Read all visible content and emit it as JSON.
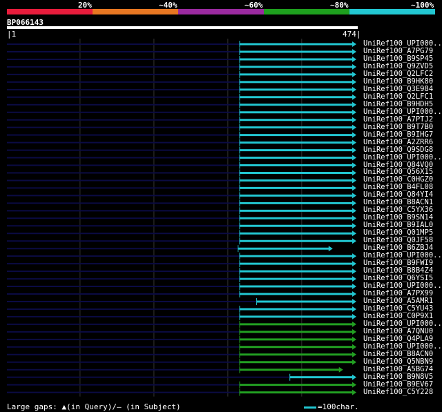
{
  "colors": {
    "dark_line": "#0b0b44",
    "cyan": "#22c7d2",
    "green": "#22a022",
    "red": "#e81c3c",
    "orange": "#e87722",
    "purple": "#9b2aa0",
    "grid": "#333333"
  },
  "legend": {
    "labels": [
      "20%",
      "~40%",
      "~60%",
      "~80%",
      "~100%"
    ],
    "colors": [
      "#e81c3c",
      "#e87722",
      "#9b2aa0",
      "#1ea01e",
      "#22c7d2"
    ]
  },
  "query": {
    "name": "BP066143",
    "start": "|1",
    "end": "474|"
  },
  "hits": [
    {
      "label": "UniRef100_UPI000..",
      "start": 316,
      "end": 474,
      "color": "cyan"
    },
    {
      "label": "UniRef100_A7PG79",
      "start": 316,
      "end": 474,
      "color": "cyan"
    },
    {
      "label": "UniRef100_B9SP45",
      "start": 316,
      "end": 474,
      "color": "cyan"
    },
    {
      "label": "UniRef100_Q9ZVD5",
      "start": 316,
      "end": 474,
      "color": "cyan"
    },
    {
      "label": "UniRef100_Q2LFC2",
      "start": 316,
      "end": 474,
      "color": "cyan"
    },
    {
      "label": "UniRef100_B9HK80",
      "start": 316,
      "end": 474,
      "color": "cyan"
    },
    {
      "label": "UniRef100_Q3E984",
      "start": 316,
      "end": 474,
      "color": "cyan"
    },
    {
      "label": "UniRef100_Q2LFC1",
      "start": 316,
      "end": 474,
      "color": "cyan"
    },
    {
      "label": "UniRef100_B9HDH5",
      "start": 316,
      "end": 474,
      "color": "cyan"
    },
    {
      "label": "UniRef100_UPI000..",
      "start": 316,
      "end": 474,
      "color": "cyan"
    },
    {
      "label": "UniRef100_A7PTJ2",
      "start": 316,
      "end": 474,
      "color": "cyan"
    },
    {
      "label": "UniRef100_B9T7B0",
      "start": 316,
      "end": 474,
      "color": "cyan"
    },
    {
      "label": "UniRef100_B9IHG7",
      "start": 316,
      "end": 474,
      "color": "cyan"
    },
    {
      "label": "UniRef100_A2ZRR6",
      "start": 316,
      "end": 474,
      "color": "cyan"
    },
    {
      "label": "UniRef100_Q9SDG8",
      "start": 316,
      "end": 474,
      "color": "cyan"
    },
    {
      "label": "UniRef100_UPI000..",
      "start": 316,
      "end": 474,
      "color": "cyan"
    },
    {
      "label": "UniRef100_Q84VQ0",
      "start": 316,
      "end": 474,
      "color": "cyan"
    },
    {
      "label": "UniRef100_Q56X15",
      "start": 316,
      "end": 474,
      "color": "cyan"
    },
    {
      "label": "UniRef100_C0HGZ0",
      "start": 316,
      "end": 474,
      "color": "cyan"
    },
    {
      "label": "UniRef100_B4FL08",
      "start": 316,
      "end": 474,
      "color": "cyan"
    },
    {
      "label": "UniRef100_Q84YI4",
      "start": 316,
      "end": 474,
      "color": "cyan"
    },
    {
      "label": "UniRef100_B8ACN1",
      "start": 316,
      "end": 474,
      "color": "cyan"
    },
    {
      "label": "UniRef100_C5YX36",
      "start": 316,
      "end": 474,
      "color": "cyan"
    },
    {
      "label": "UniRef100_B9SN14",
      "start": 316,
      "end": 474,
      "color": "cyan"
    },
    {
      "label": "UniRef100_B9IAL0",
      "start": 316,
      "end": 474,
      "color": "cyan"
    },
    {
      "label": "UniRef100_Q01MP5",
      "start": 316,
      "end": 474,
      "color": "cyan"
    },
    {
      "label": "UniRef100_Q0JF58",
      "start": 316,
      "end": 474,
      "color": "cyan"
    },
    {
      "label": "UniRef100_B6ZBJ4",
      "start": 314,
      "end": 442,
      "color": "cyan"
    },
    {
      "label": "UniRef100_UPI000..",
      "start": 316,
      "end": 474,
      "color": "cyan"
    },
    {
      "label": "UniRef100_B9FWI9",
      "start": 316,
      "end": 474,
      "color": "cyan"
    },
    {
      "label": "UniRef100_B8B4Z4",
      "start": 316,
      "end": 474,
      "color": "cyan"
    },
    {
      "label": "UniRef100_Q6YSI5",
      "start": 316,
      "end": 474,
      "color": "cyan"
    },
    {
      "label": "UniRef100_UPI000..",
      "start": 316,
      "end": 474,
      "color": "cyan"
    },
    {
      "label": "UniRef100_A7PX99",
      "start": 316,
      "end": 474,
      "color": "cyan"
    },
    {
      "label": "UniRef100_A5AMR1",
      "start": 339,
      "end": 474,
      "color": "cyan"
    },
    {
      "label": "UniRef100_C5YU43",
      "start": 316,
      "end": 474,
      "color": "cyan"
    },
    {
      "label": "UniRef100_C0P9X1",
      "start": 316,
      "end": 474,
      "color": "cyan"
    },
    {
      "label": "UniRef100_UPI000..",
      "start": 316,
      "end": 474,
      "color": "green"
    },
    {
      "label": "UniRef100_A7QNU0",
      "start": 316,
      "end": 474,
      "color": "green"
    },
    {
      "label": "UniRef100_Q4PLA9",
      "start": 316,
      "end": 474,
      "color": "green"
    },
    {
      "label": "UniRef100_UPI000..",
      "start": 316,
      "end": 474,
      "color": "green"
    },
    {
      "label": "UniRef100_B8ACN0",
      "start": 316,
      "end": 474,
      "color": "green"
    },
    {
      "label": "UniRef100_Q5NBN9",
      "start": 316,
      "end": 474,
      "color": "green"
    },
    {
      "label": "UniRef100_A5BG74",
      "start": 316,
      "end": 456,
      "color": "green"
    },
    {
      "label": "UniRef100_B9N8V5",
      "start": 384,
      "end": 474,
      "color": "cyan"
    },
    {
      "label": "UniRef100_B9EV67",
      "start": 316,
      "end": 474,
      "color": "green"
    },
    {
      "label": "UniRef100_C5Y228",
      "start": 316,
      "end": 474,
      "color": "green"
    }
  ],
  "footer": {
    "gaps_text": "Large gaps: ▲(in Query)/– (in Subject)",
    "scale_text": "=100char."
  }
}
